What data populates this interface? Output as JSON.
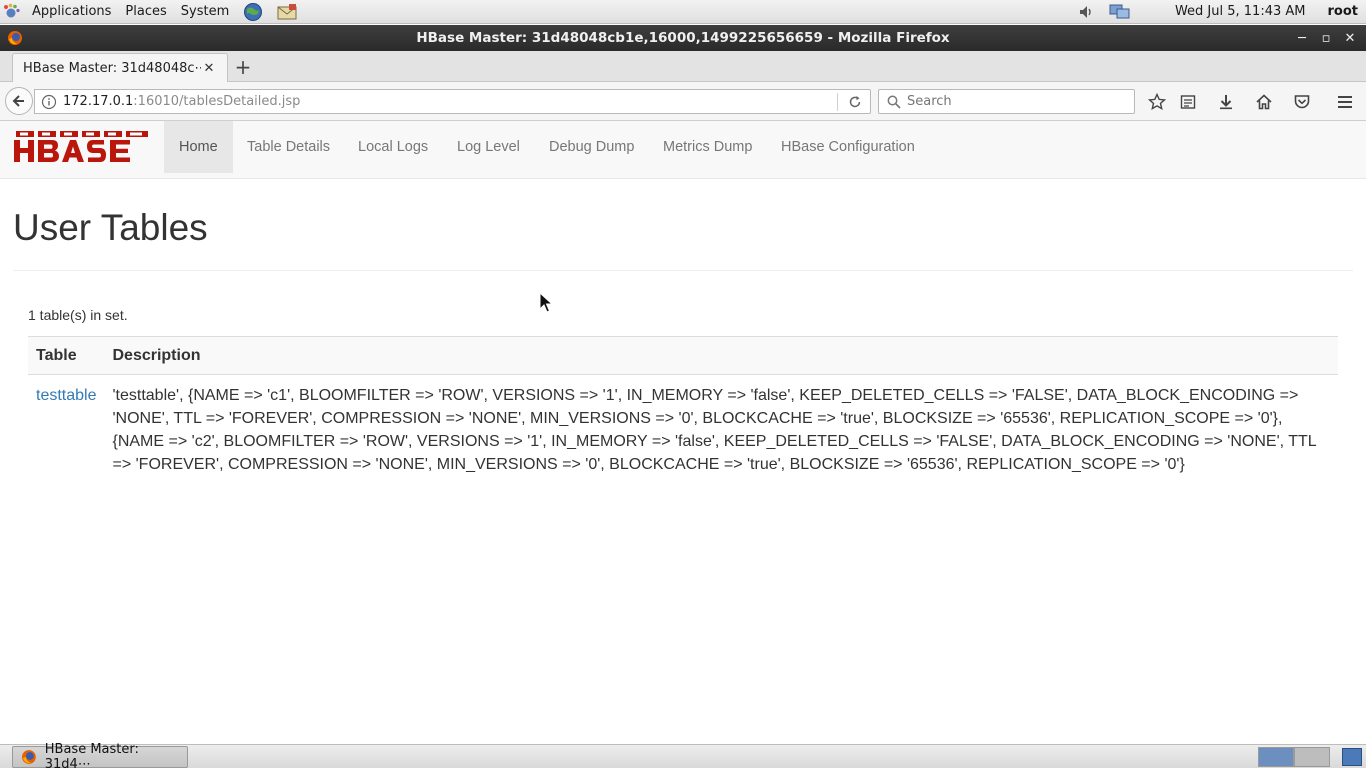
{
  "top_panel": {
    "menus": [
      "Applications",
      "Places",
      "System"
    ],
    "clock": "Wed Jul  5, 11:43 AM",
    "user": "root"
  },
  "window": {
    "title": "HBase Master: 31d48048cb1e,16000,1499225656659 - Mozilla Firefox"
  },
  "browser": {
    "tab_title": "HBase Master: 31d48048c⋯",
    "url_host": "172.17.0.1",
    "url_rest": ":16010/tablesDetailed.jsp",
    "search_placeholder": "Search"
  },
  "hbase": {
    "nav_items": [
      "Home",
      "Table Details",
      "Local Logs",
      "Log Level",
      "Debug Dump",
      "Metrics Dump",
      "HBase Configuration"
    ],
    "page_title": "User Tables",
    "table_count": "1 table(s) in set.",
    "columns": [
      "Table",
      "Description"
    ],
    "rows": [
      {
        "table": "testtable",
        "description": "'testtable', {NAME => 'c1', BLOOMFILTER => 'ROW', VERSIONS => '1', IN_MEMORY => 'false', KEEP_DELETED_CELLS => 'FALSE', DATA_BLOCK_ENCODING => 'NONE', TTL => 'FOREVER', COMPRESSION => 'NONE', MIN_VERSIONS => '0', BLOCKCACHE => 'true', BLOCKSIZE => '65536', REPLICATION_SCOPE => '0'}, {NAME => 'c2', BLOOMFILTER => 'ROW', VERSIONS => '1', IN_MEMORY => 'false', KEEP_DELETED_CELLS => 'FALSE', DATA_BLOCK_ENCODING => 'NONE', TTL => 'FOREVER', COMPRESSION => 'NONE', MIN_VERSIONS => '0', BLOCKCACHE => 'true', BLOCKSIZE => '65536', REPLICATION_SCOPE => '0'}"
      }
    ]
  },
  "taskbar": {
    "window_label": "HBase Master: 31d4⋯"
  },
  "colors": {
    "hbase_red": "#ba160c",
    "link_blue": "#337ab7",
    "titlebar": "#2f2f2f"
  }
}
